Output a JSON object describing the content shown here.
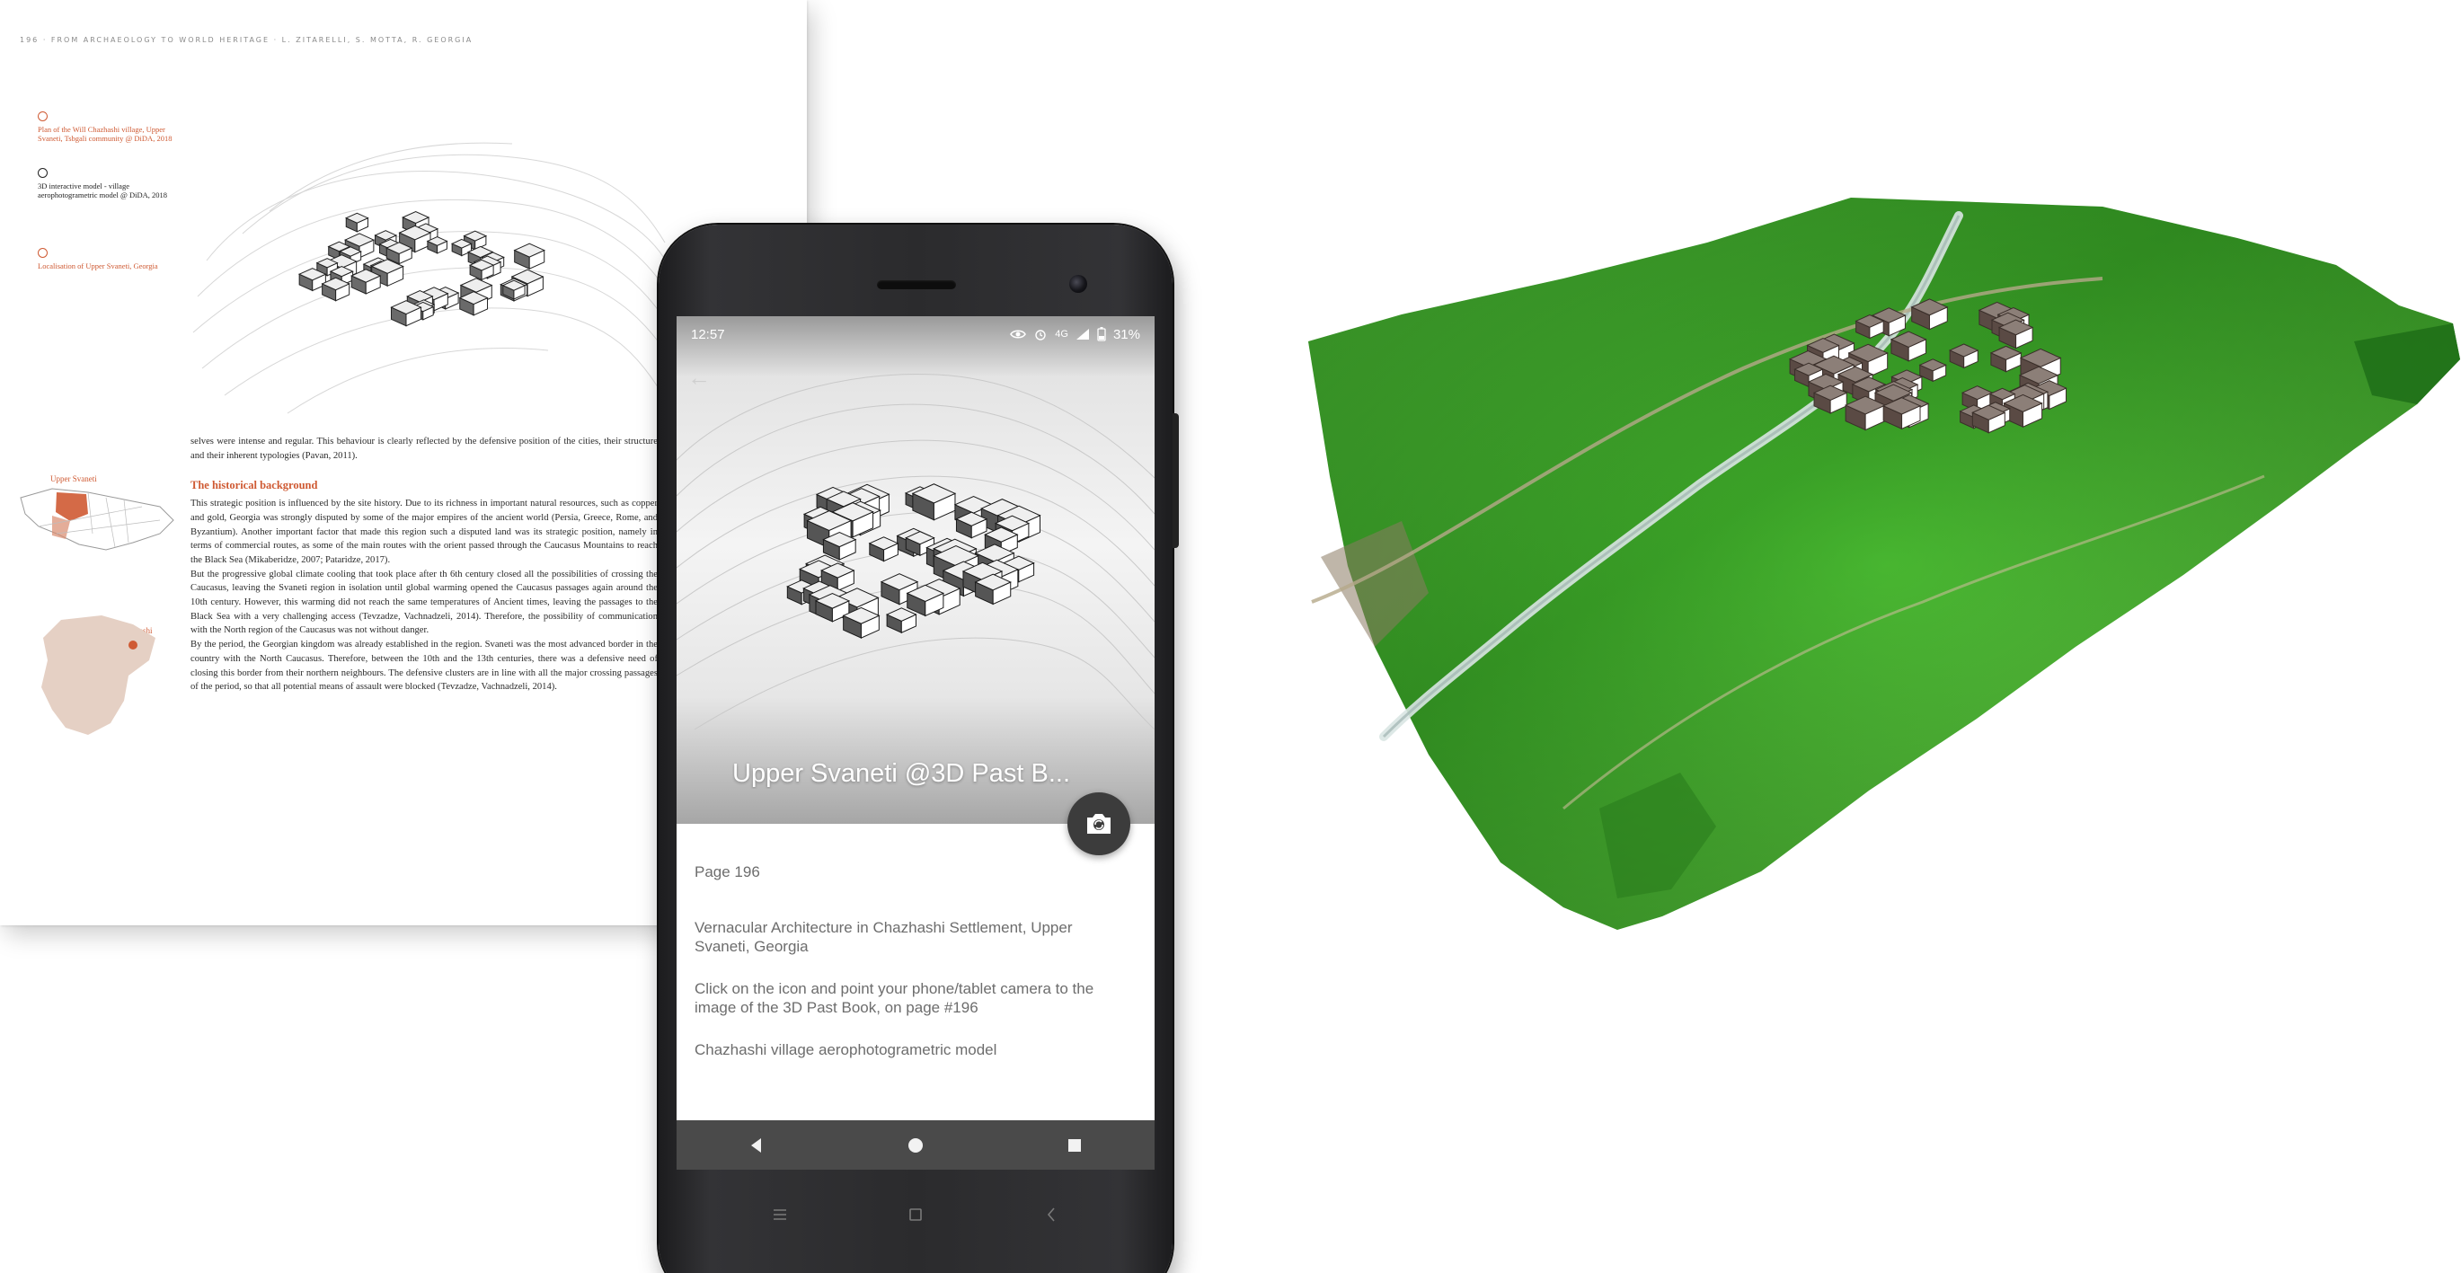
{
  "book_page": {
    "header": "196 · FROM ARCHAEOLOGY TO WORLD HERITAGE · L. ZITARELLI, S. MOTTA, R. GEORGIA",
    "captions": [
      {
        "text": "Plan of the Will Chazhashi village, Upper Svaneti, Tsbgali community @ DiDA, 2018"
      },
      {
        "text": "3D interactive model - village aerophotogrametric model @ DiDA, 2018"
      },
      {
        "text": "Localisation of Upper Svaneti, Georgia"
      }
    ],
    "map_label_top": "Upper Svaneti",
    "map_label_bottom": "Chazhashi",
    "intro_paragraph": "selves were intense and regular. This behaviour is clearly reflected by the defensive position of the cities, their structure and their inherent typologies (Pavan, 2011).",
    "section_heading": "The historical background",
    "paragraphs": [
      "This strategic position is influenced by the site history. Due to its richness in important natural resources, such as copper and gold, Georgia was strongly disputed by some of the major empires of the ancient world (Persia, Greece, Rome, and Byzantium). Another important factor that made this region such a disputed land was its strategic position, namely in terms of commercial routes, as some of the main routes with the orient passed through the Caucasus Mountains to reach the Black Sea (Mikaberidze, 2007; Pataridze, 2017).",
      "But the progressive global climate cooling that took place after th 6th century closed all the possibilities of crossing the Caucasus, leaving the Svaneti region in isolation until global warming opened the Caucasus passages again around the 10th century. However, this warming did not reach the same temperatures of Ancient times, leaving the passages to the Black Sea with a very challenging access (Tevzadze, Vachnadzeli, 2014). Therefore, the possibility of communication with the North region of the Caucasus was not without danger.",
      "By the period, the Georgian kingdom was already established in the region. Svaneti was the most advanced border in the country with the North Caucasus. Therefore, between the 10th and the 13th centuries, there was a defensive need of closing this border from their northern neighbours. The defensive clusters are in line with all the major crossing passages of the period, so that all potential means of assault were blocked (Tevzadze, Vachnadzeli, 2014)."
    ]
  },
  "phone": {
    "status_bar": {
      "time": "12:57",
      "network": "4G",
      "battery": "31%"
    },
    "app": {
      "title": "Upper Svaneti @3D Past B...",
      "page_number": "Page 196",
      "book_title": "Vernacular Architecture in Chazhashi Settlement, Upper Svaneti, Georgia",
      "instructions": "Click on the icon and point your phone/tablet camera to the image of the 3D Past Book, on page #196",
      "model_name": "Chazhashi village aerophotogrametric model"
    },
    "icons": {
      "back": "arrow-back-icon",
      "fab": "camera-switch-icon",
      "nav": [
        "back-triangle-icon",
        "home-circle-icon",
        "recents-square-icon"
      ],
      "hardware": [
        "menu-lines-icon",
        "home-square-icon",
        "back-chevron-icon"
      ]
    },
    "colors": {
      "nav_bar": "#4a4a4a",
      "fab": "#3c3c3c",
      "accent_orange": "#cf5a33",
      "grass_green": "#3fae2a"
    }
  }
}
